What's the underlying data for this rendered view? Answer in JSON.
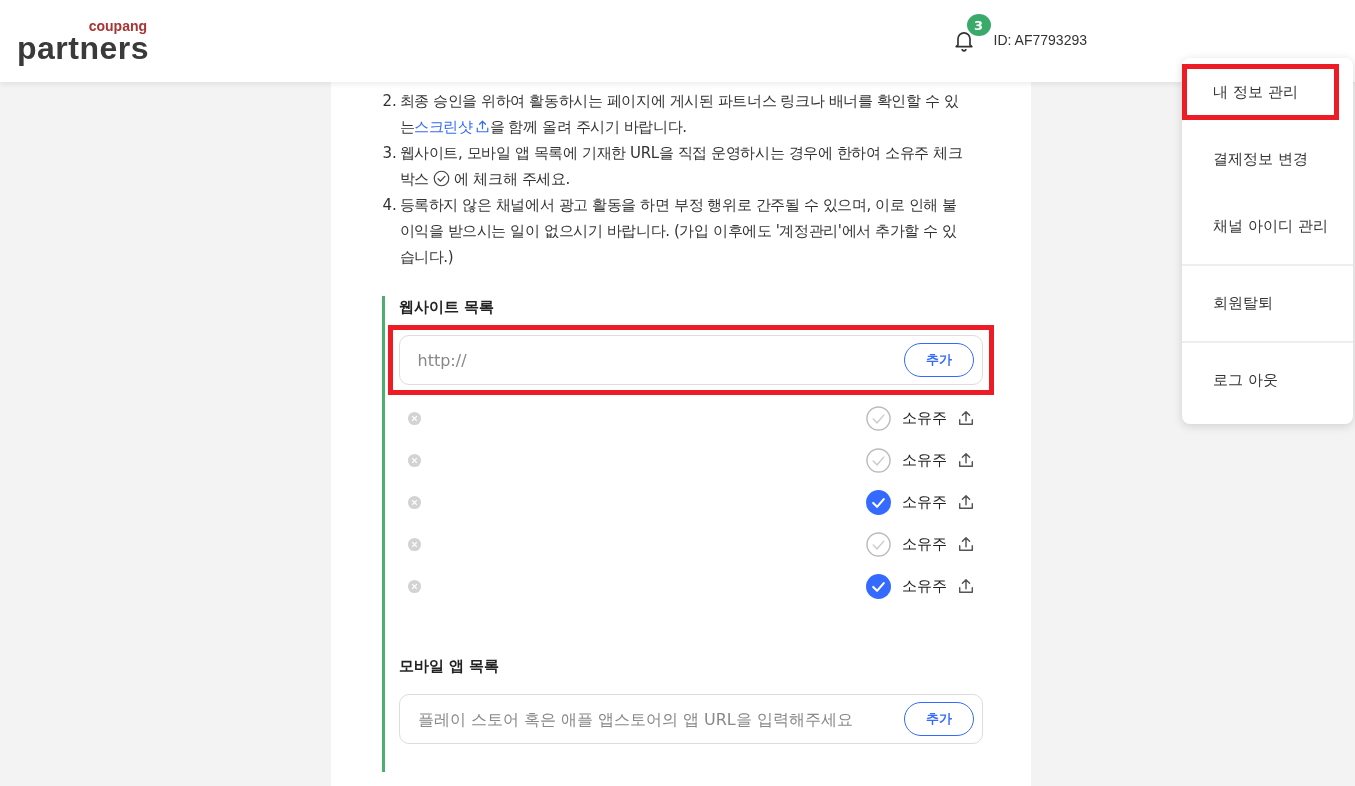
{
  "header": {
    "logo_top": "coupang",
    "logo_main": "partners",
    "notification_count": "3",
    "user_id": "ID: AF7793293"
  },
  "menu": {
    "groups": [
      {
        "items": [
          {
            "label": "내 정보 관리",
            "highlighted": true
          },
          {
            "label": "결제정보 변경",
            "highlighted": false
          },
          {
            "label": "채널 아이디 관리",
            "highlighted": false
          }
        ]
      },
      {
        "items": [
          {
            "label": "회원탈퇴",
            "highlighted": false
          }
        ]
      },
      {
        "items": [
          {
            "label": "로그 아웃",
            "highlighted": false
          }
        ]
      }
    ]
  },
  "notes": [
    {
      "number": "2.",
      "kind": "link",
      "before": "최종 승인을 위하여 활동하시는 페이지에 게시된 파트너스 링크나 배너를 확인할 수 있는",
      "link": "스크린샷",
      "after": "을 함께 올려 주시기 바랍니다."
    },
    {
      "number": "3.",
      "kind": "check",
      "before": "웹사이트, 모바일 앱 목록에 기재한 URL을 직접 운영하시는 경우에 한하여 소유주 체크박스",
      "after": " 에 체크해 주세요."
    },
    {
      "number": "4.",
      "kind": "plain",
      "before": "등록하지 않은 채널에서 광고 활동을 하면 부정 행위로 간주될 수 있으며, 이로 인해 불이익을 받으시는 일이 없으시기 바랍니다. (가입 이후에도 '계정관리'에서 추가할 수 있습니다.)"
    }
  ],
  "website_section": {
    "title": "웹사이트 목록",
    "placeholder": "http://",
    "button": "추가",
    "highlighted": true,
    "rows": [
      {
        "owner_label": "소유주",
        "checked": false
      },
      {
        "owner_label": "소유주",
        "checked": false
      },
      {
        "owner_label": "소유주",
        "checked": true
      },
      {
        "owner_label": "소유주",
        "checked": false
      },
      {
        "owner_label": "소유주",
        "checked": true
      }
    ]
  },
  "app_section": {
    "title": "모바일 앱 목록",
    "placeholder": "플레이 스토어 혹은 애플 앱스토어의 앱 URL을 입력해주세요",
    "button": "추가",
    "highlighted": false
  }
}
